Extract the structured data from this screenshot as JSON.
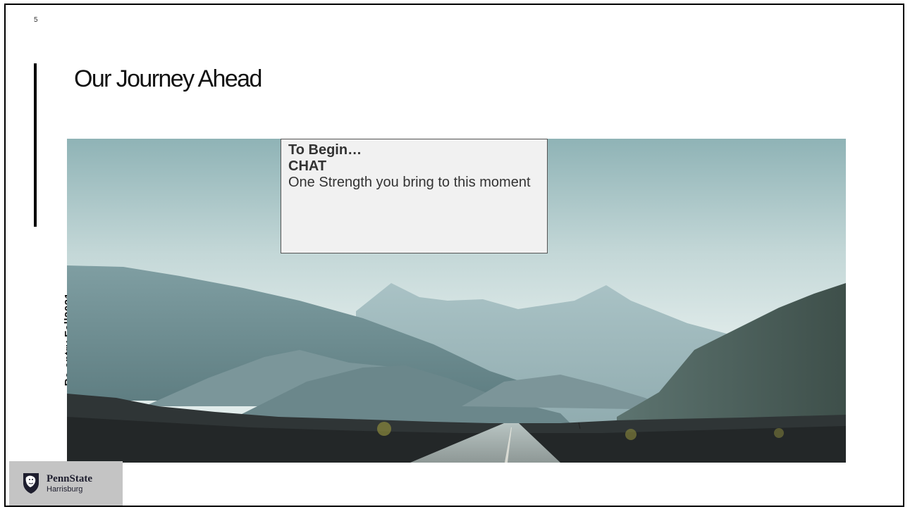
{
  "slide": {
    "number": "5",
    "title": "Our Journey Ahead",
    "side_label": "Re-entry Fall2021"
  },
  "callout": {
    "heading_line1": "To Begin…",
    "heading_line2": "CHAT",
    "body": "One Strength you bring to this moment"
  },
  "logo": {
    "brand": "PennState",
    "campus": "Harrisburg",
    "icon": "nittany-lion-shield-icon"
  },
  "colors": {
    "sky_top": "#8fb3b6",
    "sky_mid": "#d4e3e2",
    "mountain_far": "#9fb9bd",
    "mountain_mid": "#6f8e93",
    "ground": "#25282a",
    "logo_bg": "#c4c4c4",
    "callout_bg": "#f1f1f1"
  }
}
